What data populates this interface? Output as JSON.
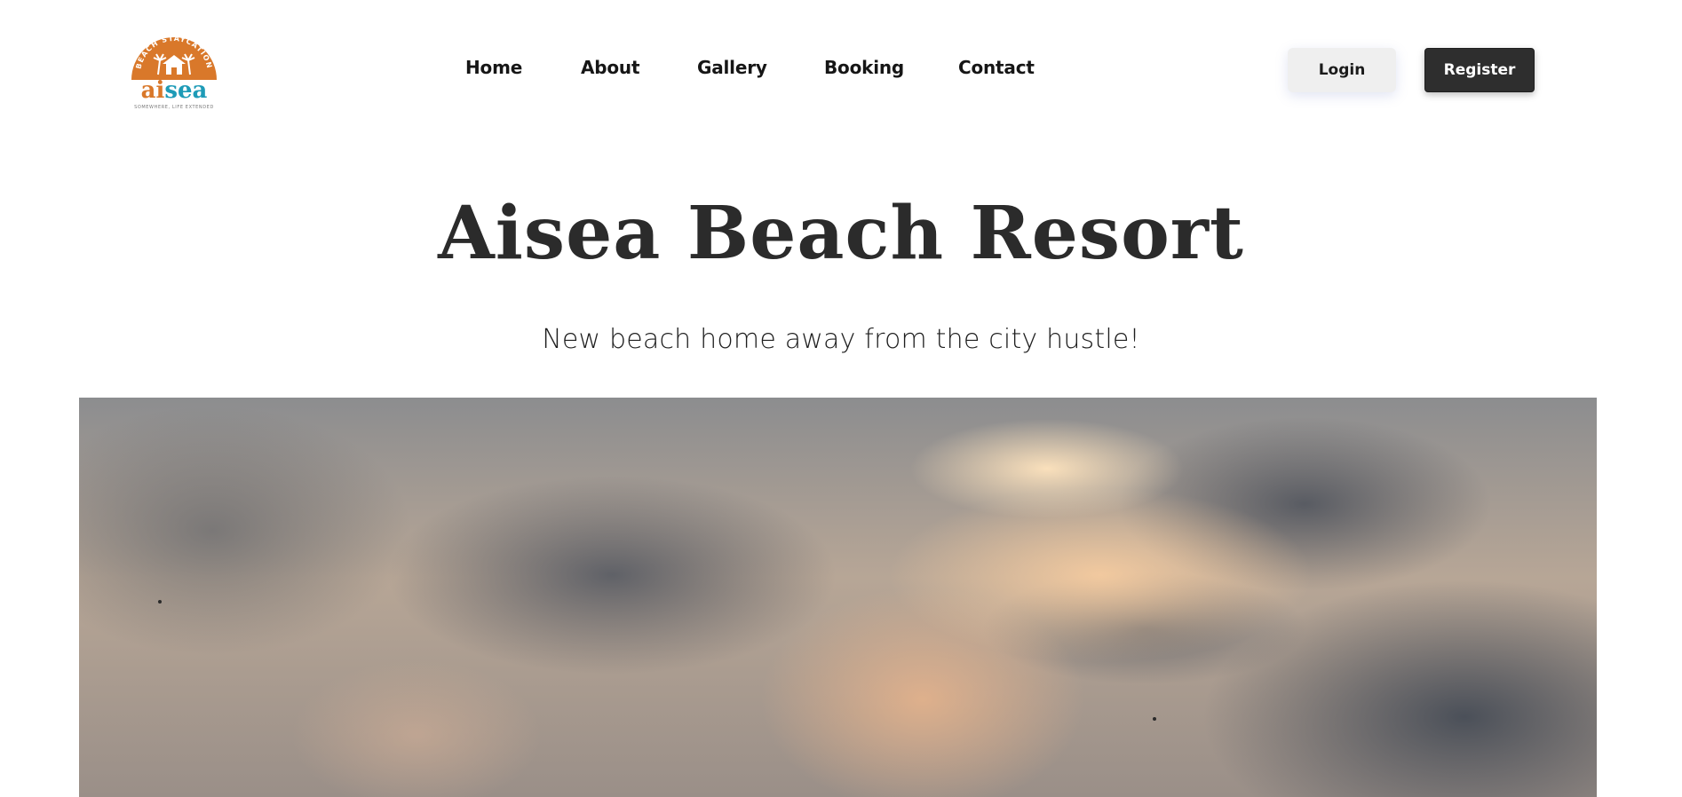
{
  "brand": {
    "logo_arc_text": "BEACH STAYCATION",
    "logo_wordmark": "aisea",
    "logo_tagline": "SOMEWHERE, LIFE EXTENDED",
    "colors": {
      "orange": "#D9782A",
      "teal": "#1E9BB7"
    }
  },
  "nav": {
    "items": [
      {
        "label": "Home"
      },
      {
        "label": "About"
      },
      {
        "label": "Gallery"
      },
      {
        "label": "Booking"
      },
      {
        "label": "Contact"
      }
    ]
  },
  "auth": {
    "login_label": "Login",
    "register_label": "Register"
  },
  "hero": {
    "title": "Aisea Beach Resort",
    "subtitle": "New beach home away from the city hustle!"
  },
  "colors": {
    "text_dark": "#2B2B2B",
    "button_dark": "#2E2E2E",
    "button_light": "#EFEFEF"
  }
}
